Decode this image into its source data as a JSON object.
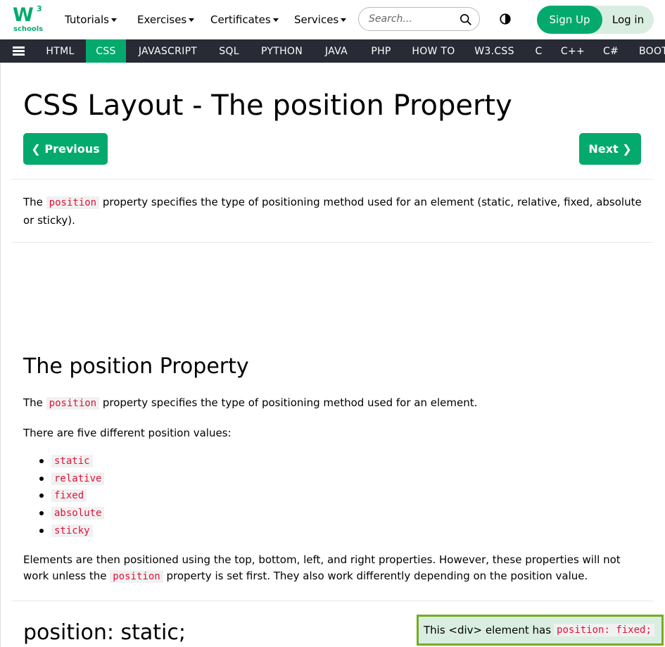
{
  "logo": {
    "main": "W",
    "sup": "3",
    "sub": "schools"
  },
  "topnav": [
    {
      "label": "Tutorials"
    },
    {
      "label": "Exercises"
    },
    {
      "label": "Certificates"
    },
    {
      "label": "Services"
    }
  ],
  "search": {
    "placeholder": "Search..."
  },
  "auth": {
    "signup": "Sign Up",
    "login": "Log in"
  },
  "subnav": [
    "HTML",
    "CSS",
    "JAVASCRIPT",
    "SQL",
    "PYTHON",
    "JAVA",
    "PHP",
    "HOW TO",
    "W3.CSS",
    "C",
    "C++",
    "C#",
    "BOOTSTRAP"
  ],
  "subnav_active": "CSS",
  "page": {
    "title": "CSS Layout - The position Property",
    "prev": "Previous",
    "next": "Next",
    "intro_pre": "The ",
    "intro_code": "position",
    "intro_post": " property specifies the type of positioning method used for an element (static, relative, fixed, absolute or sticky).",
    "section_title": "The position Property",
    "p1_pre": "The ",
    "p1_code": "position",
    "p1_post": " property specifies the type of positioning method used for an element.",
    "p2": "There are five different position values:",
    "values": [
      "static",
      "relative",
      "fixed",
      "absolute",
      "sticky"
    ],
    "p3_pre": "Elements are then positioned using the top, bottom, left, and right properties. However, these properties will not work unless the ",
    "p3_code": "position",
    "p3_post": " property is set first. They also work differently depending on the position value.",
    "section2_title": "position: static;"
  },
  "fixed_box": {
    "text": "This <div> element has",
    "code": "position: fixed;"
  },
  "colors": {
    "brand": "#04AA6D",
    "navbg": "#282A35",
    "code": "#DC143C",
    "fixedbox_bg": "#D9EEE1",
    "fixedbox_border": "#73AD21"
  }
}
